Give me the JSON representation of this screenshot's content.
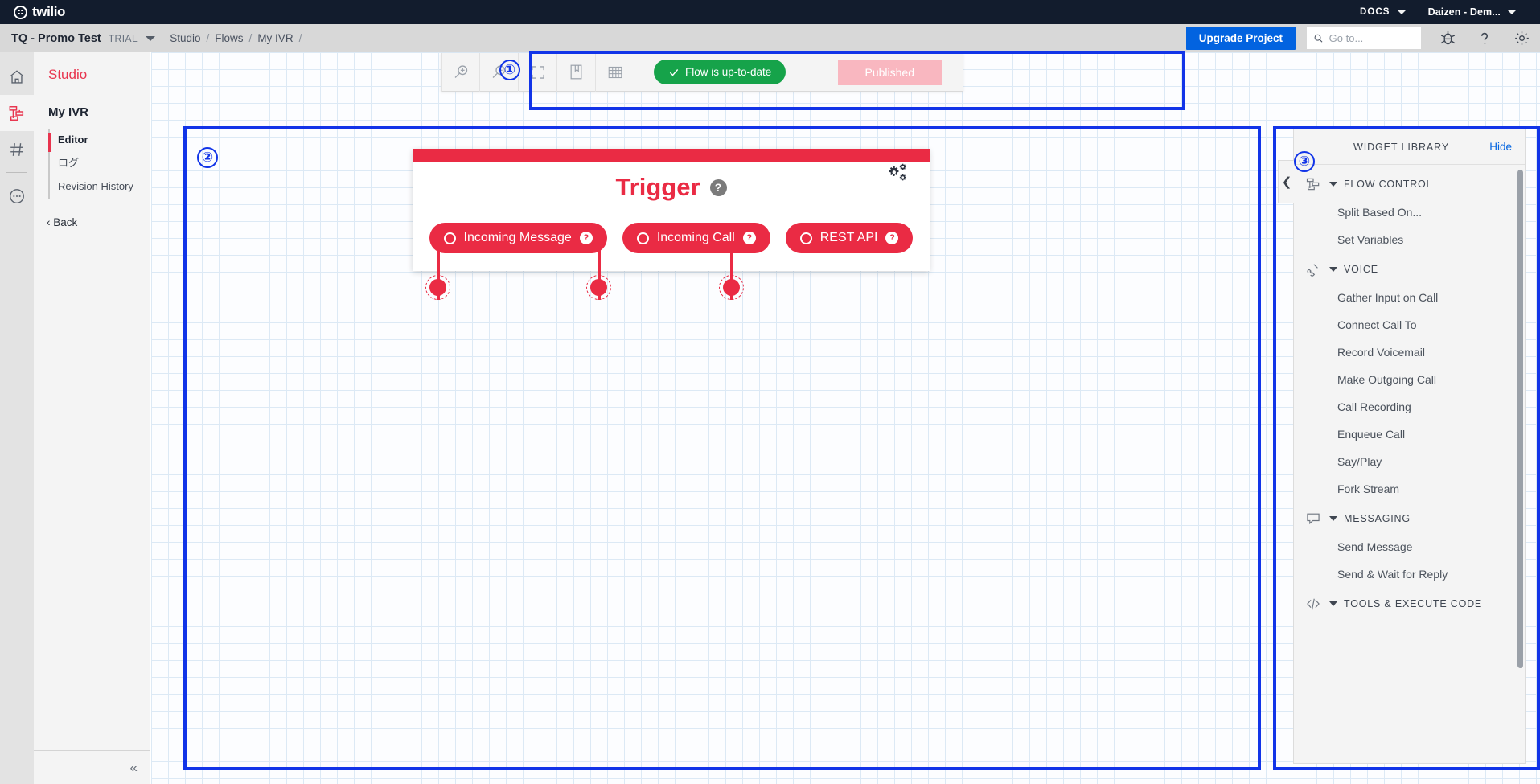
{
  "topnav": {
    "brand": "twilio",
    "brand_icon": "twilio-logo-icon",
    "docs_label": "DOCS",
    "account_label": "Daizen - Dem..."
  },
  "subheader": {
    "project_name": "TQ - Promo Test",
    "plan_badge": "TRIAL",
    "breadcrumbs": [
      "Studio",
      "/",
      "Flows",
      "/",
      "My IVR",
      "/"
    ],
    "upgrade_label": "Upgrade Project",
    "search_placeholder": "Go to...",
    "search_value": "",
    "icons": [
      "bug-icon",
      "help-icon",
      "gear-icon"
    ]
  },
  "rail": {
    "items": [
      {
        "name": "home-icon",
        "active": false
      },
      {
        "name": "studio-icon",
        "active": true
      },
      {
        "name": "hash-icon",
        "active": false
      },
      {
        "name": "more-icon",
        "active": false
      }
    ]
  },
  "sidebar": {
    "product": "Studio",
    "flow_name": "My IVR",
    "items": [
      {
        "label": "Editor",
        "active": true
      },
      {
        "label": "ログ",
        "active": false
      },
      {
        "label": "Revision History",
        "active": false
      }
    ],
    "back_label": "‹ Back",
    "collapse_icon": "collapse-left-icon"
  },
  "toolbar": {
    "buttons": [
      {
        "name": "zoom-in-icon"
      },
      {
        "name": "zoom-out-icon"
      },
      {
        "name": "fit-to-screen-icon"
      },
      {
        "name": "widget-library-icon"
      },
      {
        "name": "grid-toggle-icon"
      }
    ],
    "status_label": "Flow is up-to-date",
    "status_color": "#16a34a",
    "published_label": "Published",
    "published_color": "#f9b7c0"
  },
  "trigger": {
    "title": "Trigger",
    "help_icon": "help-icon",
    "settings_icon": "gears-icon",
    "accent_color": "#ea2b44",
    "pills": [
      {
        "label": "Incoming Message"
      },
      {
        "label": "Incoming Call"
      },
      {
        "label": "REST API"
      }
    ]
  },
  "widget_library": {
    "title": "WIDGET LIBRARY",
    "hide_label": "Hide",
    "collapse_icon": "chevron-left-icon",
    "categories": [
      {
        "label": "FLOW CONTROL",
        "icon": "flow-control-icon",
        "items": [
          "Split Based On...",
          "Set Variables"
        ]
      },
      {
        "label": "VOICE",
        "icon": "phone-icon",
        "items": [
          "Gather Input on Call",
          "Connect Call To",
          "Record Voicemail",
          "Make Outgoing Call",
          "Call Recording",
          "Enqueue Call",
          "Say/Play",
          "Fork Stream"
        ]
      },
      {
        "label": "MESSAGING",
        "icon": "chat-icon",
        "items": [
          "Send Message",
          "Send & Wait for Reply"
        ]
      },
      {
        "label": "TOOLS & EXECUTE CODE",
        "icon": "code-icon",
        "items": []
      }
    ]
  },
  "annotations": {
    "color": "#1134e8",
    "markers": [
      {
        "label": "①",
        "target": "toolbar"
      },
      {
        "label": "②",
        "target": "canvas"
      },
      {
        "label": "③",
        "target": "widget-library"
      }
    ]
  }
}
